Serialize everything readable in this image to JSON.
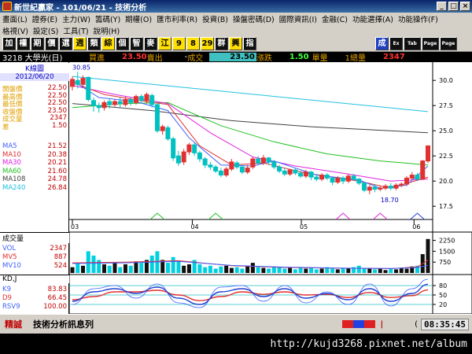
{
  "window": {
    "title": "新世紀贏家 - 101/06/21 - 技術分析",
    "min": "_",
    "max": "□",
    "close": "×"
  },
  "menu": {
    "row1": [
      "畫面(L)",
      "證券(E)",
      "主力(W)",
      "籌碼(Y)",
      "期權(O)",
      "匯市利率(R)",
      "投資(B)",
      "操盤密碼(D)",
      "國際資訊(I)",
      "金融(C)",
      "功能選擇(A)",
      "功能操作(F)"
    ],
    "row2": [
      "格視(V)",
      "設定(S)",
      "工具(T)",
      "說明(H)"
    ]
  },
  "toolbar": {
    "buttons": [
      "加",
      "權",
      "期",
      "價",
      "選",
      "週",
      "類",
      "綜",
      "個",
      "智",
      "麥",
      "江",
      "9",
      "8",
      "29",
      "群",
      "興",
      "指"
    ],
    "right": [
      "成",
      "Ex",
      "Tab",
      "Page",
      "Page"
    ]
  },
  "infobar": {
    "code": "3218 大學光(日)",
    "buy_label": "買進",
    "buy": "23.50",
    "sell_label": "賣出",
    "dash": "-",
    "deal_label": "成交",
    "deal": "23.50",
    "change_label": "漲跌",
    "change": "1.50",
    "vol_label": "單量",
    "vol": "1總量",
    "total": "2347"
  },
  "leftpanel": {
    "title": "K線圖",
    "date": "2012/06/20",
    "rows": [
      {
        "label": "開盤價",
        "value": "22.50",
        "color": "#e0a000"
      },
      {
        "label": "最高價",
        "value": "22.50",
        "color": "#e0a000"
      },
      {
        "label": "最低價",
        "value": "22.50",
        "color": "#e0a000"
      },
      {
        "label": "收盤價",
        "value": "23.50",
        "color": "#e0a000"
      },
      {
        "label": "成交量",
        "value": "2347",
        "color": "#e0a000"
      },
      {
        "label": "差",
        "value": "1.50",
        "color": "#e0a000"
      }
    ],
    "ma": [
      {
        "label": "MA5",
        "value": "21.52",
        "color": "#4060ff"
      },
      {
        "label": "MA10",
        "value": "20.38",
        "color": "#e03030"
      },
      {
        "label": "MA30",
        "value": "20.21",
        "color": "#e020e0"
      },
      {
        "label": "MA60",
        "value": "21.60",
        "color": "#20c020"
      },
      {
        "label": "MA108",
        "value": "24.78",
        "color": "#404040"
      },
      {
        "label": "MA240",
        "value": "26.84",
        "color": "#20c0e0"
      }
    ],
    "vol_title": "成交量",
    "vol": [
      {
        "label": "VOL",
        "value": "2347",
        "color": "#4060ff"
      },
      {
        "label": "MV5",
        "value": "887",
        "color": "#e03030"
      },
      {
        "label": "MV10",
        "value": "524",
        "color": "#4060ff"
      }
    ],
    "kd_title": "KD,J",
    "kd": [
      {
        "label": "K9",
        "value": "83.83",
        "color": "#4060ff"
      },
      {
        "label": "D9",
        "value": "66.45",
        "color": "#e03030"
      },
      {
        "label": "RSV9",
        "value": "100.00",
        "color": "#4060ff"
      }
    ]
  },
  "statusbar": {
    "left": "精誠",
    "message": "技術分析訊息列",
    "clock": "08:35:45"
  },
  "watermark": "http://kujd3268.pixnet.net/album",
  "chart_data": [
    {
      "type": "line",
      "title": "K線圖",
      "y_ticks": [
        "30.0",
        "27.5",
        "25.0",
        "22.5",
        "20.0",
        "17.5"
      ],
      "ylim": [
        16.5,
        31.5
      ],
      "x_ticks": [
        "03",
        "04",
        "05",
        "06"
      ],
      "annotations": [
        "30.85",
        "18.70"
      ],
      "colors": {
        "up": "#e03030",
        "down": "#00c0c0",
        "ma5": "#4060ff",
        "ma10": "#e03030",
        "ma30": "#e020e0",
        "ma60": "#20c020",
        "ma108": "#404040",
        "ma240": "#20c0e0"
      },
      "candles": [
        [
          29.4,
          30.1,
          30.4,
          29.0
        ],
        [
          30.0,
          29.6,
          30.85,
          29.2
        ],
        [
          29.6,
          30.2,
          30.5,
          29.4
        ],
        [
          30.3,
          28.1,
          30.4,
          27.9
        ],
        [
          28.0,
          27.5,
          28.3,
          26.9
        ],
        [
          27.5,
          27.3,
          27.8,
          26.8
        ],
        [
          27.3,
          27.8,
          28.0,
          27.0
        ],
        [
          27.9,
          27.6,
          28.2,
          27.2
        ],
        [
          27.6,
          27.9,
          28.1,
          27.4
        ],
        [
          27.9,
          27.7,
          28.3,
          27.3
        ],
        [
          27.6,
          28.1,
          28.4,
          27.4
        ],
        [
          28.1,
          27.8,
          28.3,
          27.5
        ],
        [
          27.8,
          28.4,
          28.6,
          27.6
        ],
        [
          28.4,
          28.0,
          28.6,
          27.8
        ],
        [
          28.0,
          28.6,
          28.8,
          27.7
        ],
        [
          28.5,
          27.6,
          28.7,
          27.3
        ],
        [
          27.6,
          25.0,
          27.7,
          24.8
        ],
        [
          25.0,
          25.4,
          25.6,
          24.6
        ],
        [
          25.3,
          24.2,
          25.5,
          24.0
        ],
        [
          24.2,
          22.3,
          24.4,
          22.0
        ],
        [
          22.5,
          21.8,
          23.0,
          21.5
        ],
        [
          21.9,
          22.9,
          23.2,
          21.6
        ],
        [
          22.9,
          23.6,
          23.8,
          22.6
        ],
        [
          23.6,
          22.8,
          23.8,
          22.5
        ],
        [
          22.8,
          22.2,
          23.0,
          21.9
        ],
        [
          22.2,
          21.6,
          22.4,
          21.3
        ],
        [
          21.6,
          21.4,
          21.9,
          21.1
        ],
        [
          21.4,
          21.0,
          21.6,
          20.8
        ],
        [
          21.0,
          20.6,
          21.3,
          20.4
        ],
        [
          20.6,
          21.2,
          21.4,
          20.4
        ],
        [
          21.2,
          21.9,
          22.2,
          21.0
        ],
        [
          21.8,
          21.4,
          22.0,
          21.2
        ],
        [
          21.4,
          20.9,
          21.6,
          20.7
        ],
        [
          20.9,
          21.3,
          21.6,
          20.7
        ],
        [
          21.4,
          22.2,
          22.4,
          21.2
        ],
        [
          22.2,
          21.8,
          22.5,
          21.6
        ],
        [
          21.8,
          22.3,
          22.6,
          21.6
        ],
        [
          22.3,
          21.9,
          22.4,
          21.6
        ],
        [
          21.9,
          21.4,
          22.1,
          21.2
        ],
        [
          21.4,
          21.0,
          21.6,
          20.8
        ],
        [
          21.0,
          20.7,
          21.3,
          20.5
        ],
        [
          20.7,
          21.1,
          21.2,
          20.5
        ],
        [
          21.1,
          20.8,
          21.3,
          20.6
        ],
        [
          20.8,
          20.5,
          21.0,
          20.3
        ],
        [
          20.5,
          20.9,
          21.1,
          20.3
        ],
        [
          20.9,
          20.4,
          21.0,
          20.1
        ],
        [
          20.4,
          20.2,
          20.7,
          20.0
        ],
        [
          20.2,
          20.6,
          20.8,
          20.0
        ],
        [
          20.6,
          20.3,
          20.8,
          20.1
        ],
        [
          20.3,
          19.9,
          20.4,
          19.6
        ],
        [
          19.9,
          20.3,
          20.5,
          19.7
        ],
        [
          20.3,
          20.0,
          20.5,
          19.7
        ],
        [
          20.0,
          20.5,
          20.7,
          19.8
        ],
        [
          20.5,
          20.2,
          20.7,
          20.0
        ],
        [
          20.2,
          19.8,
          20.3,
          19.6
        ],
        [
          19.8,
          19.1,
          19.9,
          18.9
        ],
        [
          19.1,
          19.4,
          19.6,
          18.7
        ],
        [
          19.4,
          19.2,
          19.7,
          18.9
        ],
        [
          19.2,
          19.3,
          19.5,
          19.0
        ],
        [
          19.3,
          19.5,
          19.7,
          19.1
        ],
        [
          19.5,
          19.3,
          19.8,
          19.1
        ],
        [
          19.3,
          19.6,
          19.8,
          19.1
        ],
        [
          19.6,
          19.7,
          19.9,
          19.4
        ],
        [
          19.7,
          20.3,
          20.5,
          19.5
        ],
        [
          20.3,
          20.6,
          20.9,
          20.1
        ],
        [
          20.6,
          20.2,
          20.8,
          20.0
        ],
        [
          20.2,
          22.0,
          22.1,
          20.1
        ],
        [
          22.0,
          23.5,
          23.5,
          21.8
        ]
      ],
      "ma240": [
        [
          0,
          30.4
        ],
        [
          67,
          26.9
        ]
      ],
      "ma108": [
        [
          0,
          27.7
        ],
        [
          15,
          27.0
        ],
        [
          30,
          26.0
        ],
        [
          45,
          25.4
        ],
        [
          60,
          25.0
        ],
        [
          67,
          24.8
        ]
      ],
      "ma60": [
        [
          0,
          27.3
        ],
        [
          10,
          27.7
        ],
        [
          18,
          27.8
        ],
        [
          28,
          25.5
        ],
        [
          38,
          23.9
        ],
        [
          48,
          22.7
        ],
        [
          58,
          22.0
        ],
        [
          67,
          21.6
        ]
      ],
      "ma30": [
        [
          0,
          29.5
        ],
        [
          8,
          28.6
        ],
        [
          18,
          27.7
        ],
        [
          26,
          24.8
        ],
        [
          34,
          22.4
        ],
        [
          42,
          21.5
        ],
        [
          52,
          20.7
        ],
        [
          60,
          20.0
        ],
        [
          67,
          20.2
        ]
      ],
      "ma10": [
        [
          0,
          29.8
        ],
        [
          6,
          28.6
        ],
        [
          14,
          27.9
        ],
        [
          18,
          27.6
        ],
        [
          24,
          23.5
        ],
        [
          30,
          21.6
        ],
        [
          36,
          21.8
        ],
        [
          44,
          20.8
        ],
        [
          54,
          20.0
        ],
        [
          60,
          19.3
        ],
        [
          67,
          20.4
        ]
      ],
      "ma5": [
        [
          0,
          30.0
        ],
        [
          5,
          28.3
        ],
        [
          12,
          27.9
        ],
        [
          18,
          27.0
        ],
        [
          22,
          24.3
        ],
        [
          28,
          21.6
        ],
        [
          34,
          21.5
        ],
        [
          38,
          22.0
        ],
        [
          46,
          20.6
        ],
        [
          54,
          20.1
        ],
        [
          58,
          19.3
        ],
        [
          63,
          19.6
        ],
        [
          67,
          21.5
        ]
      ]
    },
    {
      "type": "bar",
      "title": "成交量",
      "y_ticks": [
        "2250",
        "1500",
        "750"
      ],
      "ylim": [
        0,
        2500
      ],
      "values": [
        400,
        700,
        500,
        1500,
        1200,
        900,
        600,
        500,
        700,
        400,
        600,
        500,
        800,
        700,
        900,
        1200,
        1500,
        900,
        700,
        1100,
        800,
        500,
        600,
        900,
        600,
        400,
        500,
        300,
        450,
        500,
        350,
        400,
        300,
        500,
        700,
        400,
        350,
        300,
        450,
        400,
        300,
        350,
        250,
        400,
        300,
        350,
        250,
        300,
        400,
        300,
        250,
        350,
        300,
        400,
        500,
        300,
        350,
        250,
        300,
        200,
        300,
        250,
        350,
        300,
        450,
        500,
        1300,
        2347
      ],
      "mv5": [
        [
          0,
          700
        ],
        [
          10,
          750
        ],
        [
          20,
          850
        ],
        [
          30,
          500
        ],
        [
          40,
          380
        ],
        [
          50,
          330
        ],
        [
          60,
          300
        ],
        [
          65,
          420
        ],
        [
          67,
          887
        ]
      ],
      "mv10": [
        [
          0,
          650
        ],
        [
          10,
          700
        ],
        [
          20,
          800
        ],
        [
          30,
          520
        ],
        [
          40,
          400
        ],
        [
          50,
          340
        ],
        [
          60,
          310
        ],
        [
          65,
          380
        ],
        [
          67,
          524
        ]
      ]
    },
    {
      "type": "line",
      "title": "KD,J",
      "y_ticks": [
        "80",
        "50",
        "20"
      ],
      "ylim": [
        0,
        100
      ],
      "k9": [
        [
          0,
          30
        ],
        [
          4,
          60
        ],
        [
          8,
          70
        ],
        [
          12,
          55
        ],
        [
          16,
          75
        ],
        [
          20,
          40
        ],
        [
          24,
          20
        ],
        [
          28,
          60
        ],
        [
          32,
          70
        ],
        [
          36,
          45
        ],
        [
          40,
          70
        ],
        [
          44,
          40
        ],
        [
          48,
          55
        ],
        [
          52,
          35
        ],
        [
          56,
          70
        ],
        [
          60,
          30
        ],
        [
          64,
          55
        ],
        [
          67,
          84
        ]
      ],
      "d9": [
        [
          0,
          35
        ],
        [
          4,
          45
        ],
        [
          8,
          60
        ],
        [
          12,
          60
        ],
        [
          16,
          65
        ],
        [
          20,
          50
        ],
        [
          24,
          32
        ],
        [
          28,
          45
        ],
        [
          32,
          60
        ],
        [
          36,
          52
        ],
        [
          40,
          60
        ],
        [
          44,
          50
        ],
        [
          48,
          52
        ],
        [
          52,
          42
        ],
        [
          56,
          58
        ],
        [
          60,
          42
        ],
        [
          64,
          48
        ],
        [
          67,
          66
        ]
      ],
      "rsv9": [
        [
          0,
          20
        ],
        [
          4,
          70
        ],
        [
          8,
          80
        ],
        [
          12,
          40
        ],
        [
          16,
          85
        ],
        [
          20,
          25
        ],
        [
          24,
          10
        ],
        [
          28,
          75
        ],
        [
          32,
          80
        ],
        [
          36,
          30
        ],
        [
          40,
          80
        ],
        [
          44,
          25
        ],
        [
          48,
          60
        ],
        [
          52,
          20
        ],
        [
          56,
          85
        ],
        [
          60,
          15
        ],
        [
          64,
          70
        ],
        [
          67,
          100
        ]
      ]
    }
  ]
}
